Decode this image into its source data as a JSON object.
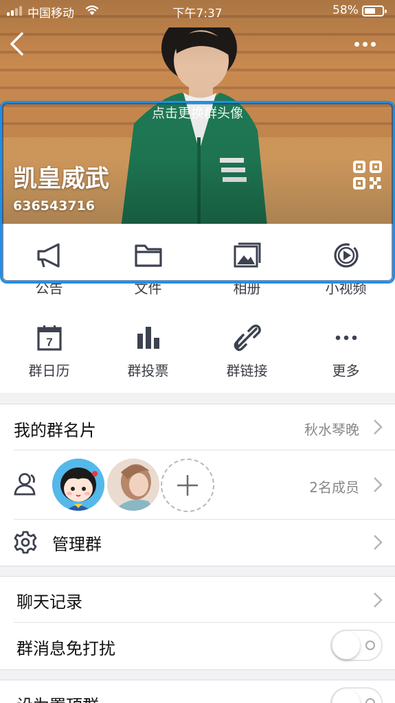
{
  "status_bar": {
    "carrier": "中国移动",
    "time": "下午7:37",
    "battery": "58%"
  },
  "header": {
    "change_avatar_hint": "点击更换群头像",
    "group_name": "凯皇威武",
    "group_id": "636543716"
  },
  "functions": [
    {
      "label": "公告",
      "icon": "megaphone-icon"
    },
    {
      "label": "文件",
      "icon": "folder-icon"
    },
    {
      "label": "相册",
      "icon": "photo-album-icon"
    },
    {
      "label": "小视频",
      "icon": "video-play-icon"
    },
    {
      "label": "群日历",
      "icon": "calendar-icon"
    },
    {
      "label": "群投票",
      "icon": "bar-chart-icon"
    },
    {
      "label": "群链接",
      "icon": "link-icon"
    },
    {
      "label": "更多",
      "icon": "more-dots-icon"
    }
  ],
  "calendar_day": "7",
  "my_card": {
    "label": "我的群名片",
    "value": "秋水琴晚"
  },
  "members": {
    "count_label": "2名成员"
  },
  "manage": {
    "label": "管理群"
  },
  "chat_history": {
    "label": "聊天记录"
  },
  "mute": {
    "label": "群消息免打扰",
    "on": false
  },
  "pin": {
    "label": "设为置顶群",
    "on": false
  },
  "colors": {
    "icon": "#3d4250",
    "highlight": "#1e8fe6",
    "text_secondary": "#888888"
  }
}
